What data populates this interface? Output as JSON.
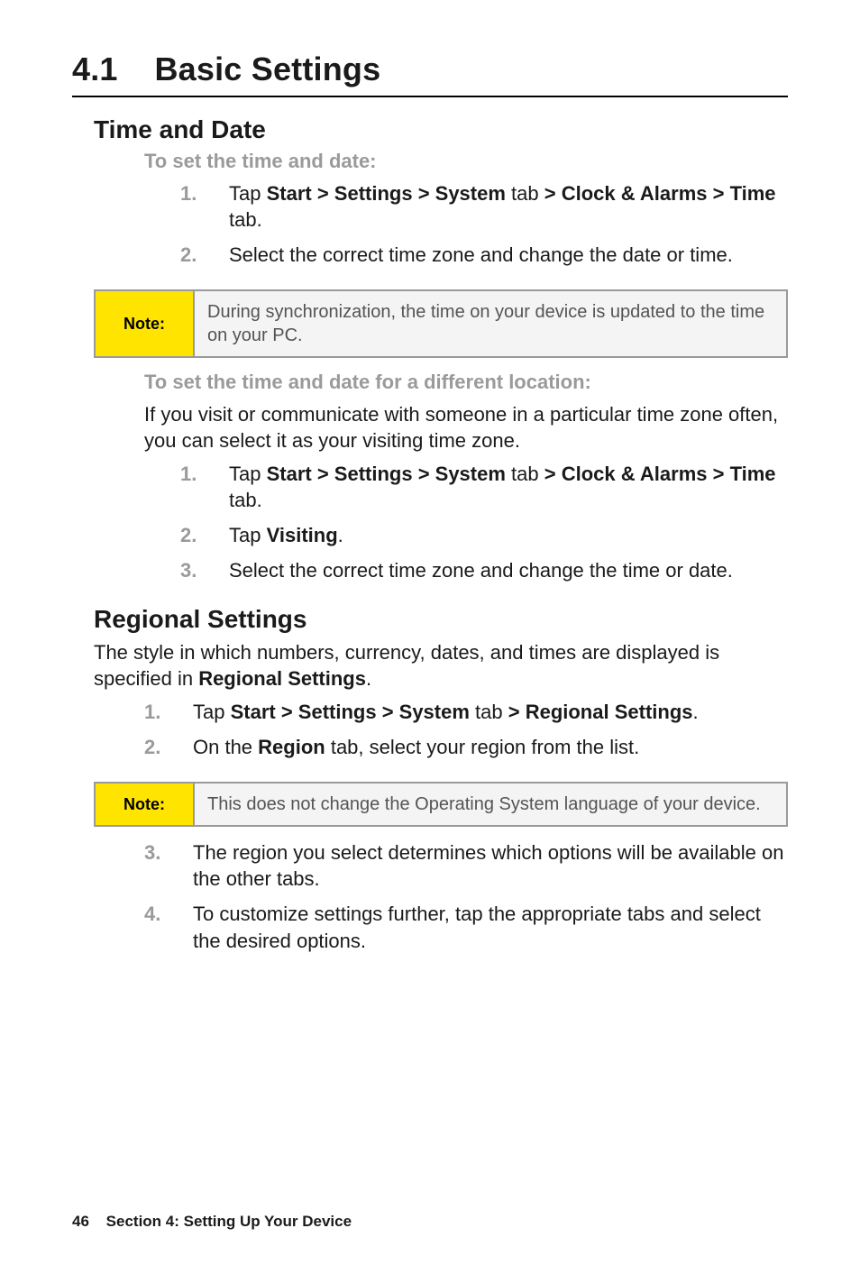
{
  "section_number": "4.1",
  "section_title": "Basic Settings",
  "time_date": {
    "heading": "Time and Date",
    "to_set": "To set the time and date:",
    "steps_a": [
      {
        "pre": "Tap ",
        "bold1": "Start > Settings > System",
        "mid": " tab ",
        "bold2": "> Clock & Alarms > Time",
        "post": " tab."
      },
      {
        "text": "Select the correct time zone and change the date or time."
      }
    ],
    "note_label": "Note:",
    "note_text": "During synchronization, the time on your device is updated to the time on your PC.",
    "to_set_different": "To set the time and date for a different location:",
    "diff_para": "If you visit or communicate with someone in a particular time zone often, you can select it as your visiting time zone.",
    "steps_b": [
      {
        "pre": "Tap ",
        "bold1": "Start > Settings > System",
        "mid": " tab ",
        "bold2": "> Clock & Alarms > Time",
        "post": " tab."
      },
      {
        "pre": "Tap ",
        "bold1": "Visiting",
        "post": "."
      },
      {
        "text": "Select the correct time zone and change the time or date."
      }
    ]
  },
  "regional": {
    "heading": "Regional Settings",
    "intro_pre": "The style in which numbers, currency, dates, and times are displayed is specified in ",
    "intro_bold": "Regional Settings",
    "intro_post": ".",
    "steps_a": [
      {
        "pre": "Tap ",
        "bold1": "Start > Settings > System",
        "mid": " tab ",
        "bold2": "> Regional Settings",
        "post": "."
      },
      {
        "pre": "On the ",
        "bold1": "Region",
        "post": " tab, select your region from the list."
      }
    ],
    "note_label": "Note:",
    "note_text": "This does not change the Operating System language of your device.",
    "steps_b": [
      {
        "text": "The region you select determines which options will be available on the other tabs."
      },
      {
        "text": "To customize settings further, tap the appropriate tabs and select the desired options."
      }
    ]
  },
  "footer": {
    "page": "46",
    "section_label": "Section 4: Setting Up Your Device"
  }
}
